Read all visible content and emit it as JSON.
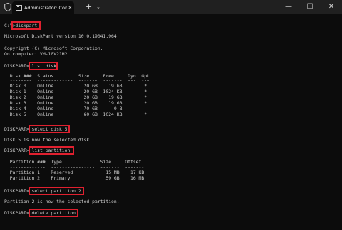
{
  "titlebar": {
    "tab_title": "Administrator: Command Prompt",
    "close_tab_glyph": "×",
    "new_tab_glyph": "+",
    "dropdown_glyph": "⌄",
    "minimize_glyph": "—",
    "maximize_glyph": "☐",
    "close_window_glyph": "✕",
    "shield_icon": "shield-icon",
    "tab_icon": "cmd-icon"
  },
  "terminal": {
    "lines": [
      "C:\\>diskpart",
      "",
      "Microsoft DiskPart version 10.0.19041.964",
      "",
      "Copyright (C) Microsoft Corporation.",
      "On computer: VM-10V21H2",
      "",
      "DISKPART> list disk",
      "",
      "  Disk ###  Status         Size     Free     Dyn  Gpt",
      "  --------  -------------  -------  -------  ---  ---",
      "  Disk 0    Online           20 GB    19 GB        *",
      "  Disk 1    Online           20 GB  1024 KB        *",
      "  Disk 2    Online           20 GB    19 GB        *",
      "  Disk 3    Online           20 GB    19 GB        *",
      "  Disk 4    Online           70 GB      0 B",
      "  Disk 5    Online           60 GB  1024 KB        *",
      "",
      "DISKPART> select disk 5",
      "",
      "Disk 5 is now the selected disk.",
      "",
      "DISKPART> list partition",
      "",
      "  Partition ###  Type              Size     Offset",
      "  -------------  ----------------  -------  -------",
      "  Partition 1    Reserved            15 MB    17 KB",
      "  Partition 2    Primary             59 GB    16 MB",
      "",
      "DISKPART> select partition 2",
      "",
      "Partition 2 is now the selected partition.",
      "",
      "DISKPART> delete partition"
    ]
  },
  "colors": {
    "highlight": "#e0202f",
    "terminal_bg": "#0c0c0c",
    "text": "#cccccc",
    "titlebar_bg": "#202020"
  }
}
